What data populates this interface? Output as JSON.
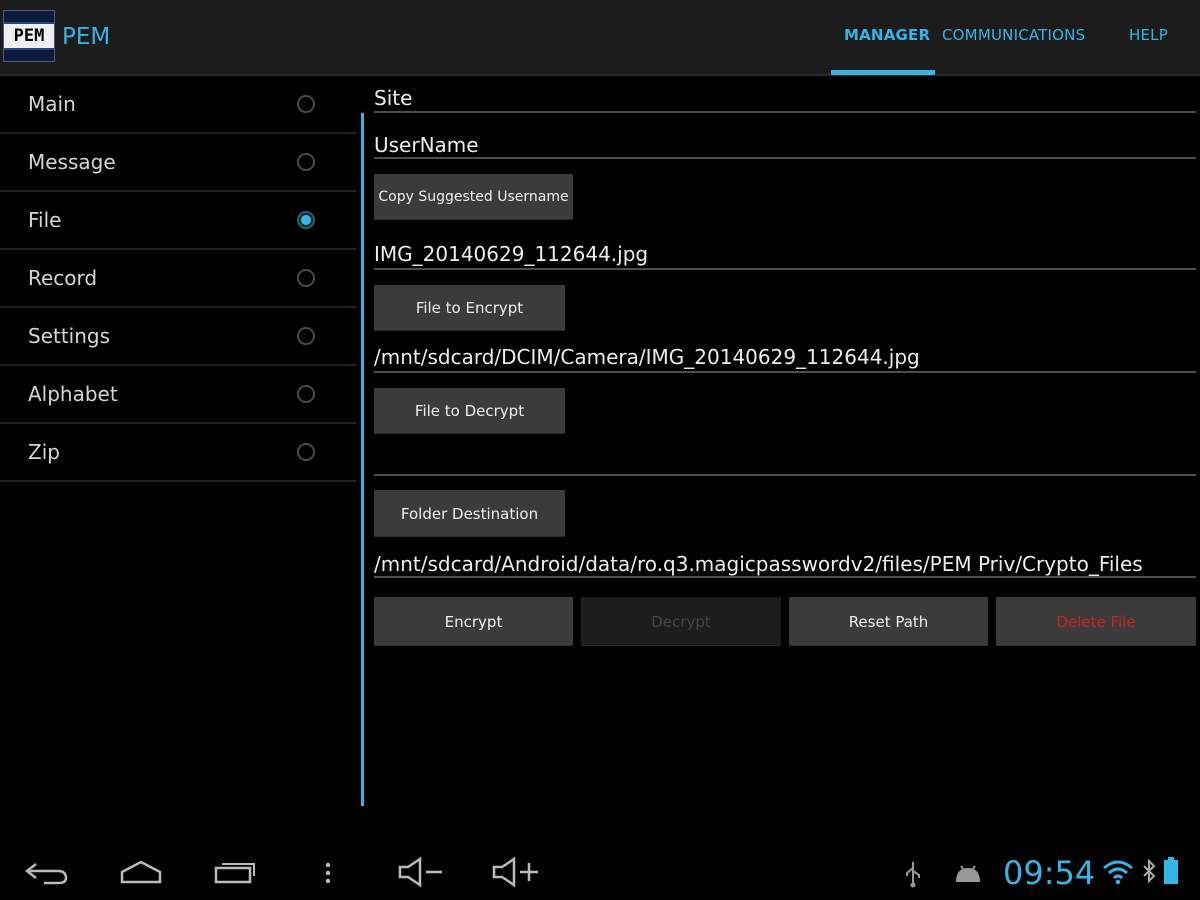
{
  "app": {
    "logo_text": "PEM",
    "title": "PEM"
  },
  "tabs": [
    {
      "label": "MANAGER",
      "active": true
    },
    {
      "label": "COMMUNICATIONS",
      "active": false
    },
    {
      "label": "HELP",
      "active": false
    }
  ],
  "nav": {
    "items": [
      {
        "label": "Main",
        "checked": false
      },
      {
        "label": "Message",
        "checked": false
      },
      {
        "label": "File",
        "checked": true
      },
      {
        "label": "Record",
        "checked": false
      },
      {
        "label": "Settings",
        "checked": false
      },
      {
        "label": "Alphabet",
        "checked": false
      },
      {
        "label": "Zip",
        "checked": false
      }
    ]
  },
  "form": {
    "site_label": "Site",
    "username_label": "UserName",
    "copy_username_button": "Copy Suggested Username",
    "selected_file": "IMG_20140629_112644.jpg",
    "file_to_encrypt_button": "File to Encrypt",
    "encrypt_path": "/mnt/sdcard/DCIM/Camera/IMG_20140629_112644.jpg",
    "file_to_decrypt_button": "File to Decrypt",
    "decrypt_path": "",
    "folder_destination_button": "Folder Destination",
    "destination_path": "/mnt/sdcard/Android/data/ro.q3.magicpasswordv2/files/PEM Priv/Crypto_Files"
  },
  "actions": {
    "encrypt": "Encrypt",
    "decrypt": "Decrypt",
    "reset_path": "Reset Path",
    "delete_file": "Delete File"
  },
  "system_bar": {
    "time": "09:54",
    "icons": [
      "back-icon",
      "home-icon",
      "recent-apps-icon",
      "menu-icon",
      "volume-down-icon",
      "volume-up-icon",
      "usb-icon",
      "android-debug-icon",
      "wifi-icon",
      "bluetooth-icon",
      "battery-icon"
    ]
  },
  "colors": {
    "accent": "#33b5e5",
    "danger": "#cc2222",
    "button": "#3b3b3b"
  }
}
